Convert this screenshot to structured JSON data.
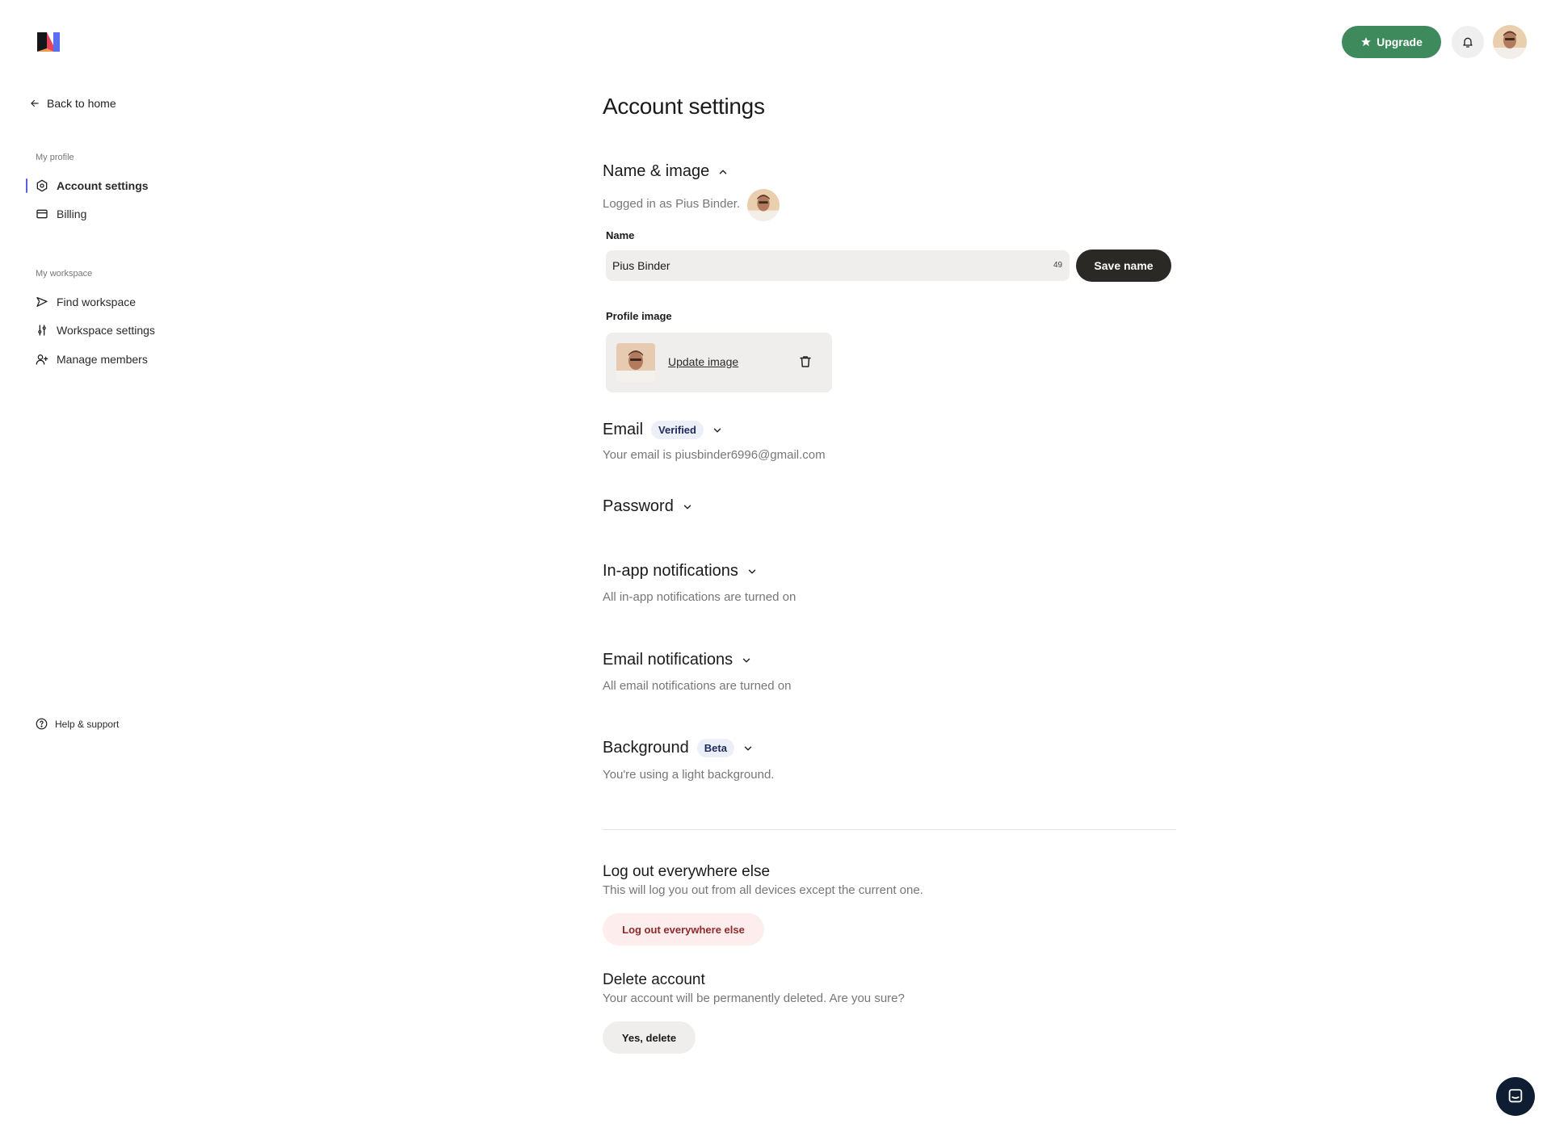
{
  "header": {
    "upgrade_label": "Upgrade",
    "logo_icon": "brand-logo",
    "bell_icon": "bell-icon",
    "avatar_icon": "user-avatar"
  },
  "sidebar": {
    "back_label": "Back to home",
    "groups": [
      {
        "title": "My profile",
        "items": [
          {
            "label": "Account settings",
            "icon": "hexagon-settings-icon",
            "active": true
          },
          {
            "label": "Billing",
            "icon": "credit-card-icon",
            "active": false
          }
        ]
      },
      {
        "title": "My workspace",
        "items": [
          {
            "label": "Find workspace",
            "icon": "send-arrow-icon",
            "active": false
          },
          {
            "label": "Workspace settings",
            "icon": "sliders-icon",
            "active": false
          },
          {
            "label": "Manage members",
            "icon": "user-add-icon",
            "active": false
          }
        ]
      }
    ],
    "help_label": "Help & support"
  },
  "main": {
    "title": "Account settings",
    "name_image": {
      "title": "Name & image",
      "logged_in_text": "Logged in as Pius Binder.",
      "name_label": "Name",
      "name_value": "Pius Binder",
      "char_count": "49",
      "save_label": "Save name",
      "profile_image_label": "Profile image",
      "update_image_label": "Update image"
    },
    "email": {
      "title": "Email",
      "badge": "Verified",
      "description": "Your email is piusbinder6996@gmail.com"
    },
    "password": {
      "title": "Password"
    },
    "inapp": {
      "title": "In-app notifications",
      "description": "All in-app notifications are turned on"
    },
    "email_notifications": {
      "title": "Email notifications",
      "description": "All email notifications are turned on"
    },
    "background": {
      "title": "Background",
      "badge": "Beta",
      "description": "You're using a light background."
    },
    "logout": {
      "title": "Log out everywhere else",
      "description": "This will log you out from all devices except the current one.",
      "button_label": "Log out everywhere else"
    },
    "delete": {
      "title": "Delete account",
      "description": "Your account will be permanently deleted. Are you sure?",
      "button_label": "Yes, delete"
    }
  },
  "colors": {
    "accent_green": "#3f8a5c",
    "active_indicator": "#5a5fe6",
    "dark_button": "#2b2926",
    "danger_text": "#8e2a2a",
    "chat_button": "#0f1d33"
  }
}
